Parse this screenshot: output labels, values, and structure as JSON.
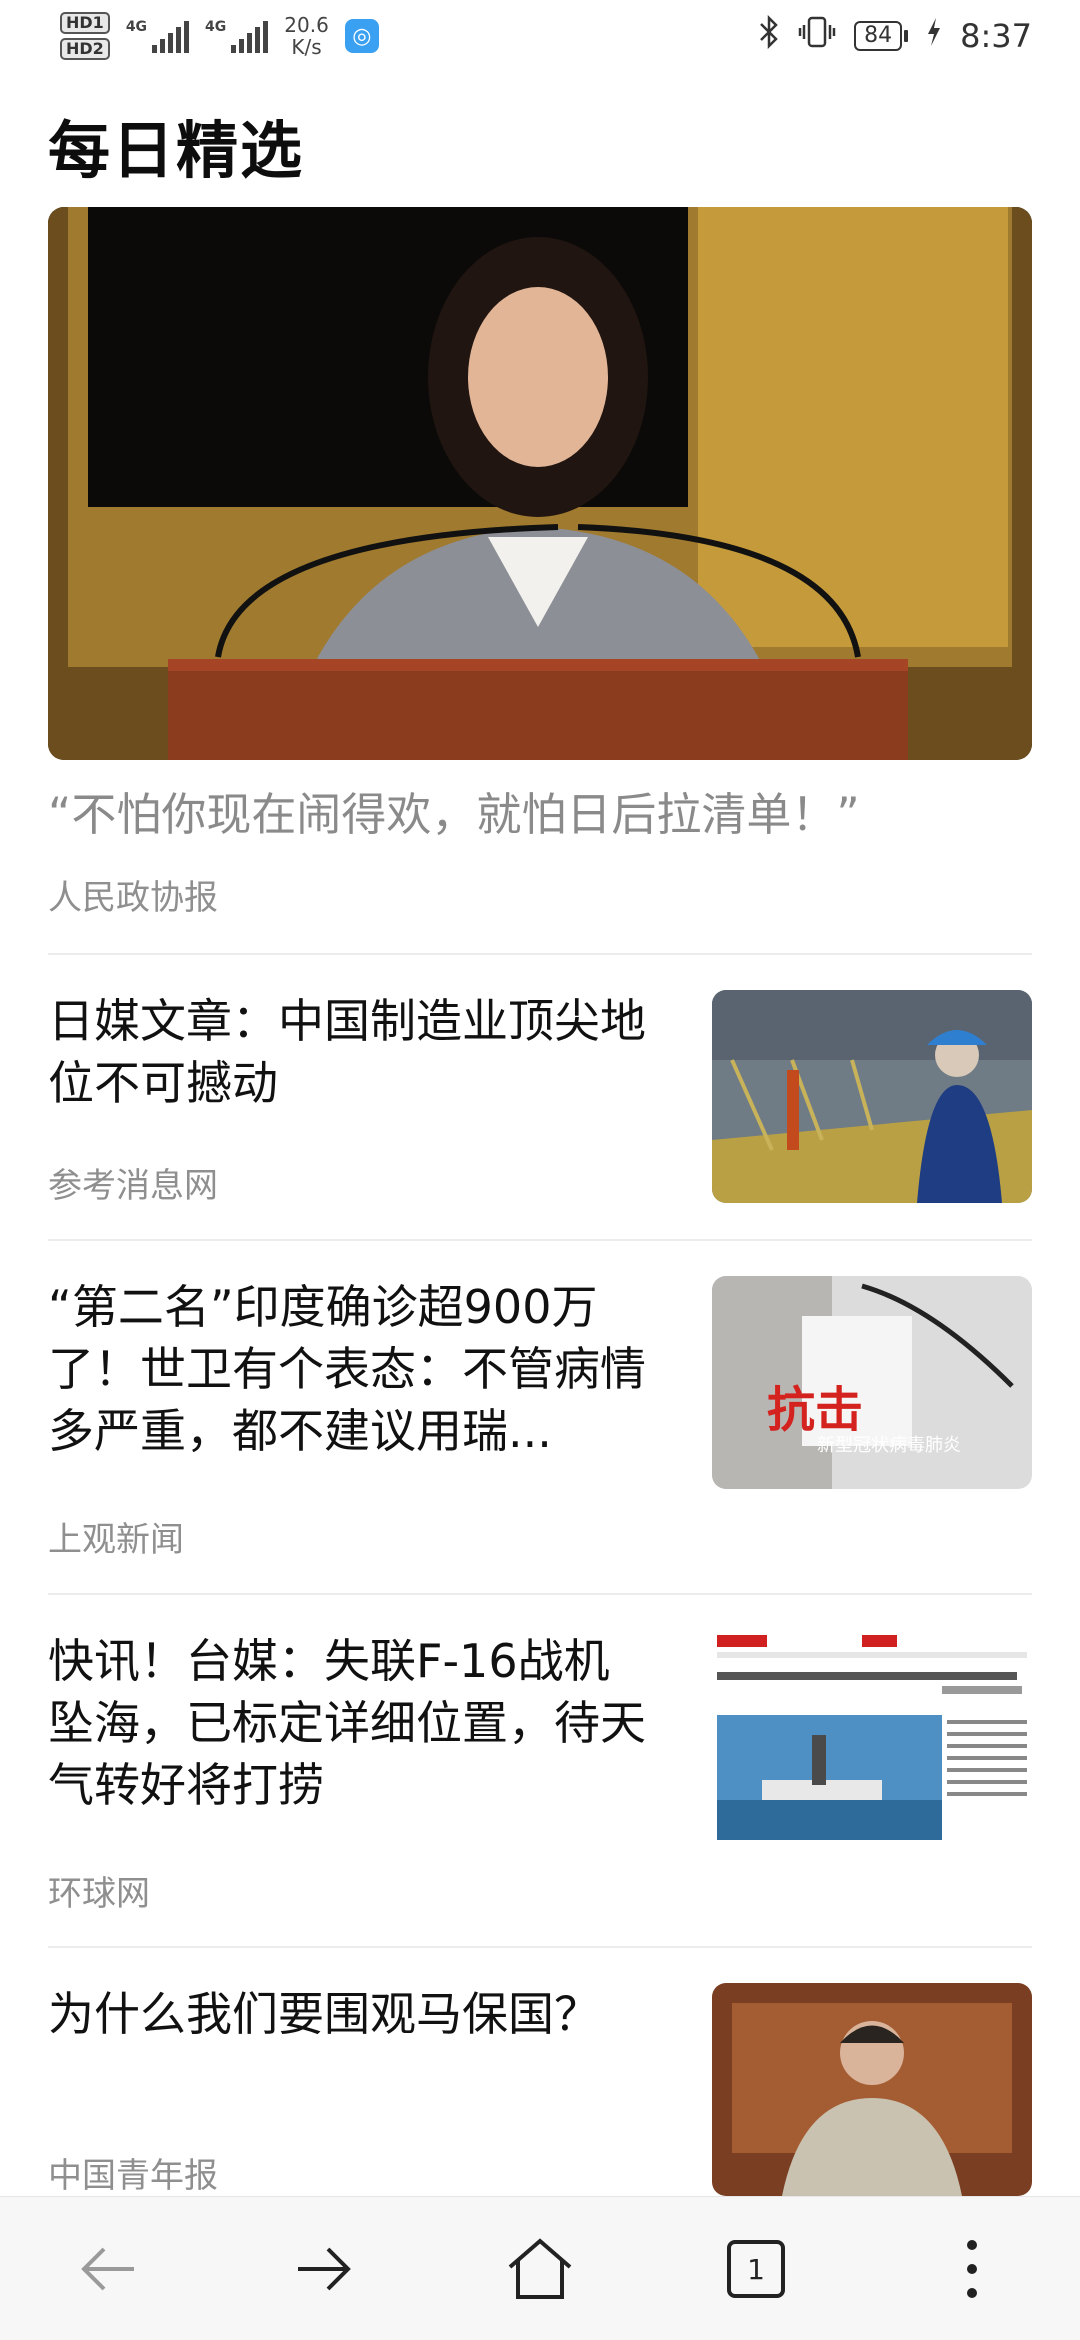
{
  "status_bar": {
    "hd1": "HD1",
    "hd2": "HD2",
    "signal1_label": "4G",
    "signal2_label": "4G",
    "speed_value": "20.6",
    "speed_unit": "K/s",
    "battery": "84",
    "time": "8:37",
    "icons": [
      "globe-app-icon",
      "bluetooth-icon",
      "vibrate-icon",
      "battery-icon",
      "charging-icon"
    ]
  },
  "page": {
    "title": "每日精选"
  },
  "hero": {
    "quote": "“不怕你现在闹得欢，就怕日后拉清单！”",
    "source": "人民政协报"
  },
  "news": [
    {
      "title": "日媒文章：中国制造业顶尖地位不可撼动",
      "source": "参考消息网",
      "thumb": "factory-worker-photo"
    },
    {
      "title": "“第二名”印度确诊超900万了！世卫有个表态：不管病情多严重，都不建议用瑞...",
      "source": "上观新闻",
      "thumb": "press-conference-photo"
    },
    {
      "title": "快讯！台媒：失联F-16战机坠海，已标定详细位置，待天气转好将打捞",
      "source": "环球网",
      "thumb": "news-website-screenshot"
    },
    {
      "title": "为什么我们要围观马保国？",
      "source": "中国青年报",
      "thumb": "man-portrait-photo"
    }
  ],
  "nav": {
    "tab_count": "1",
    "icons": [
      "back-arrow-icon",
      "forward-arrow-icon",
      "home-icon",
      "tabs-icon",
      "more-icon"
    ]
  }
}
